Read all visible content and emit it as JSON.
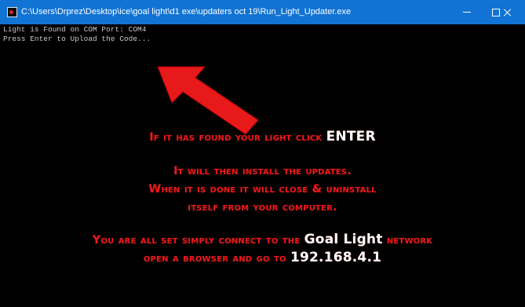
{
  "window": {
    "title": "C:\\Users\\Drprez\\Desktop\\ice\\goal light\\d1 exe\\updaters oct 19\\Run_Light_Updater.exe",
    "controls": {
      "minimize_icon": "minimize-icon",
      "maximize_icon": "maximize-icon",
      "close_icon": "close-icon"
    },
    "colors": {
      "titlebar": "#1173d4",
      "console_bg": "#000000",
      "console_text": "#c8c8c8",
      "overlay_red": "#e8191a",
      "overlay_white": "#ffffff"
    }
  },
  "console": {
    "lines": [
      "Light is Found on COM Port: COM4",
      "Press Enter to Upload the Code..."
    ]
  },
  "overlay": {
    "arrow_icon": "red-arrow-icon",
    "line1_prefix": "If it has found your light click ",
    "line1_key": "ENTER",
    "line2": "It will then install the updates.",
    "line3": "When it is done it will close & uninstall",
    "line4": "itself from your computer.",
    "line5_prefix": "You are all set simply connect to the ",
    "line5_network": "Goal Light",
    "line5_suffix": " network",
    "line6_prefix": "open a browser and go to ",
    "line6_address": "192.168.4.1"
  }
}
